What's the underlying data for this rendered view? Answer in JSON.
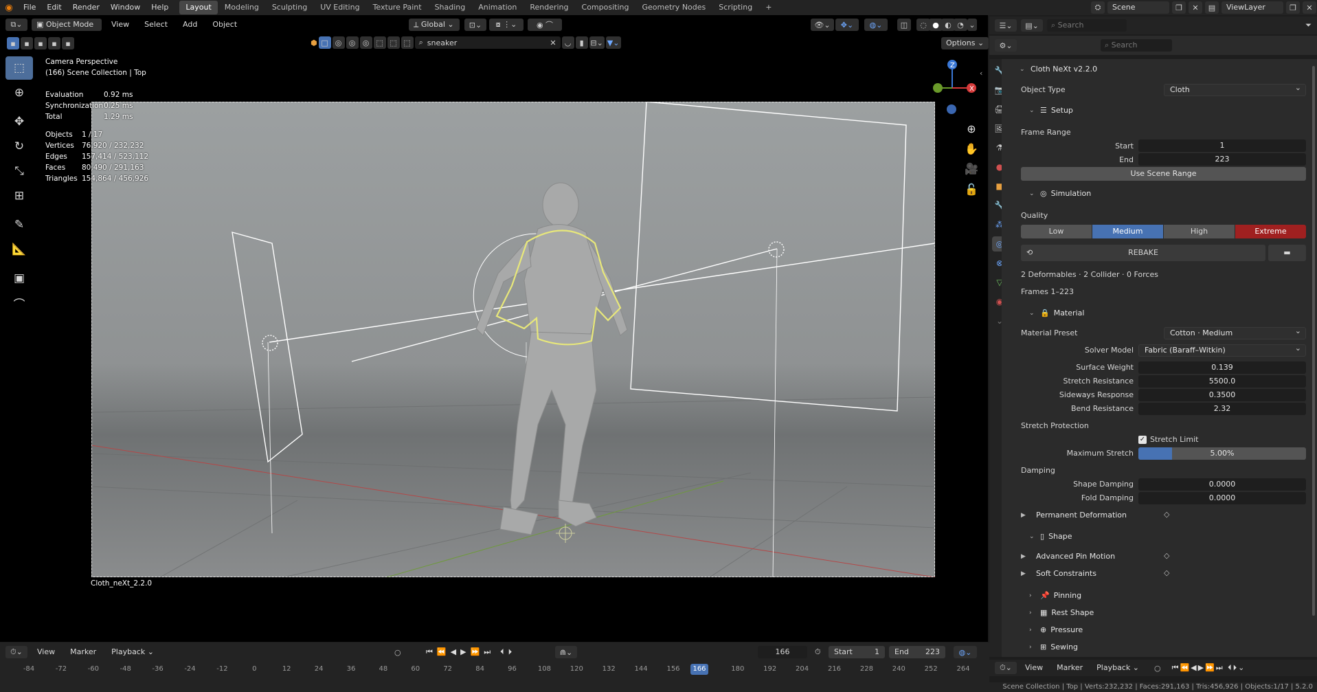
{
  "menu": {
    "items": [
      "File",
      "Edit",
      "Render",
      "Window",
      "Help"
    ]
  },
  "workspaces": [
    "Layout",
    "Modeling",
    "Sculpting",
    "UV Editing",
    "Texture Paint",
    "Shading",
    "Animation",
    "Rendering",
    "Compositing",
    "Geometry Nodes",
    "Scripting"
  ],
  "active_workspace": "Layout",
  "scene": {
    "name": "Scene",
    "view_layer": "ViewLayer"
  },
  "viewport_header": {
    "mode": "Object Mode",
    "menus": [
      "View",
      "Select",
      "Add",
      "Object"
    ],
    "orientation": "Global",
    "search_value": "sneaker",
    "options": "Options"
  },
  "overlay_text": {
    "perspective": "Camera Perspective",
    "collection": "(166) Scene Collection | Top",
    "stats": [
      {
        "k": "Evaluation",
        "v": "0.92 ms"
      },
      {
        "k": "Synchronization",
        "v": "0.25 ms"
      },
      {
        "k": "Total",
        "v": "1.29 ms"
      }
    ],
    "counts": [
      {
        "k": "Objects",
        "v": "1 / 17"
      },
      {
        "k": "Vertices",
        "v": "76,920 / 232,232"
      },
      {
        "k": "Edges",
        "v": "157,414 / 523,112"
      },
      {
        "k": "Faces",
        "v": "80,490 / 291,163"
      },
      {
        "k": "Triangles",
        "v": "154,864 / 456,926"
      }
    ],
    "camera_name": "Cloth_neXt_2.2.0"
  },
  "props_search": "Search",
  "panel": {
    "title": "Cloth NeXt  v2.2.0",
    "object_type_label": "Object Type",
    "object_type_value": "Cloth",
    "setup": "Setup",
    "frame_range": "Frame Range",
    "start_label": "Start",
    "start_value": "1",
    "end_label": "End",
    "end_value": "223",
    "use_scene_range": "Use Scene Range",
    "simulation": "Simulation",
    "quality_label": "Quality",
    "quality": [
      "Low",
      "Medium",
      "High",
      "Extreme"
    ],
    "rebake": "REBAKE",
    "summary": "2 Deformables · 2 Collider · 0 Forces",
    "frames": "Frames 1–223",
    "material": "Material",
    "material_preset_label": "Material Preset",
    "material_preset_value": "Cotton · Medium",
    "solver_model_label": "Solver Model",
    "solver_model_value": "Fabric (Baraff–Witkin)",
    "fields": [
      {
        "label": "Surface Weight",
        "value": "0.139"
      },
      {
        "label": "Stretch Resistance",
        "value": "5500.0"
      },
      {
        "label": "Sideways Response",
        "value": "0.3500"
      },
      {
        "label": "Bend Resistance",
        "value": "2.32"
      }
    ],
    "stretch_protection": "Stretch Protection",
    "stretch_limit": "Stretch Limit",
    "max_stretch_label": "Maximum Stretch",
    "max_stretch_value": "5.00%",
    "max_stretch_fraction": 0.2,
    "damping": "Damping",
    "shape_damping_label": "Shape Damping",
    "shape_damping_value": "0.0000",
    "fold_damping_label": "Fold Damping",
    "fold_damping_value": "0.0000",
    "permanent_deformation": "Permanent Deformation",
    "shape": "Shape",
    "advanced_pin_motion": "Advanced Pin Motion",
    "soft_constraints": "Soft Constraints",
    "pinning": "Pinning",
    "rest_shape": "Rest Shape",
    "pressure": "Pressure",
    "sewing": "Sewing"
  },
  "timeline": {
    "menus": [
      "View",
      "Marker",
      "Playback"
    ],
    "current_frame": "166",
    "start_label": "Start",
    "start_value": "1",
    "end_label": "End",
    "end_value": "223",
    "ticks": [
      "-84",
      "-72",
      "-60",
      "-48",
      "-36",
      "-24",
      "-12",
      "0",
      "12",
      "24",
      "36",
      "48",
      "60",
      "72",
      "84",
      "96",
      "108",
      "120",
      "132",
      "144",
      "156",
      "166",
      "180",
      "192",
      "204",
      "216",
      "228",
      "240",
      "252",
      "264"
    ]
  },
  "props_timeline": {
    "menus": [
      "View",
      "Marker",
      "Playback"
    ]
  },
  "status_bar": "Scene Collection | Top | Verts:232,232 | Faces:291,163 | Tris:456,926 | Objects:1/17 | 5.2.0",
  "colors": {
    "accent": "#4772b3",
    "extreme": "#a02020",
    "selection": "#e8e87a"
  }
}
